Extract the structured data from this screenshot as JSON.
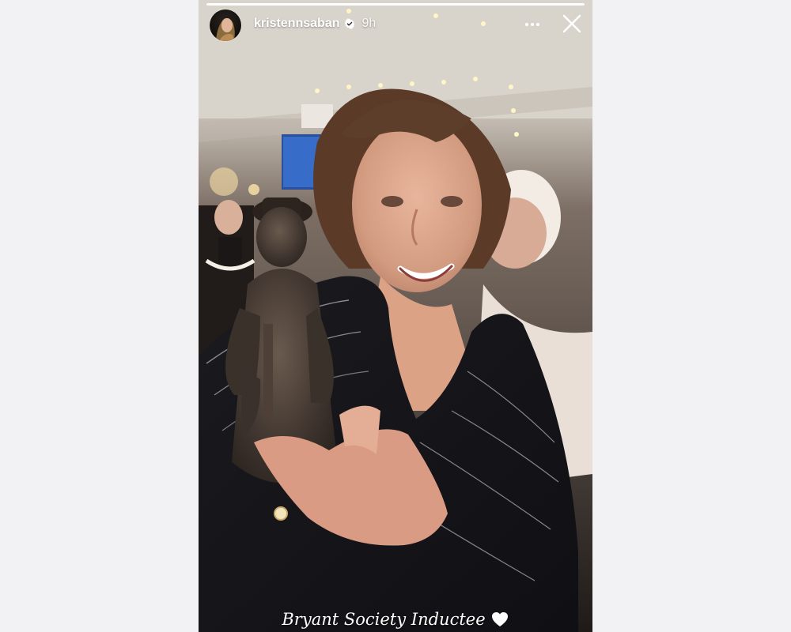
{
  "story": {
    "username": "kristennsaban",
    "time": "9h",
    "verified": true,
    "caption": "Bryant Society Inductee",
    "progress": 1.0
  },
  "icons": {
    "verified": "verified-badge-icon",
    "more": "more-horizontal-icon",
    "close": "close-icon",
    "heart": "white-heart-icon"
  },
  "colors": {
    "page_background": "#f2f2f4",
    "text": "#ffffff",
    "verified_badge": "#ffffff"
  }
}
